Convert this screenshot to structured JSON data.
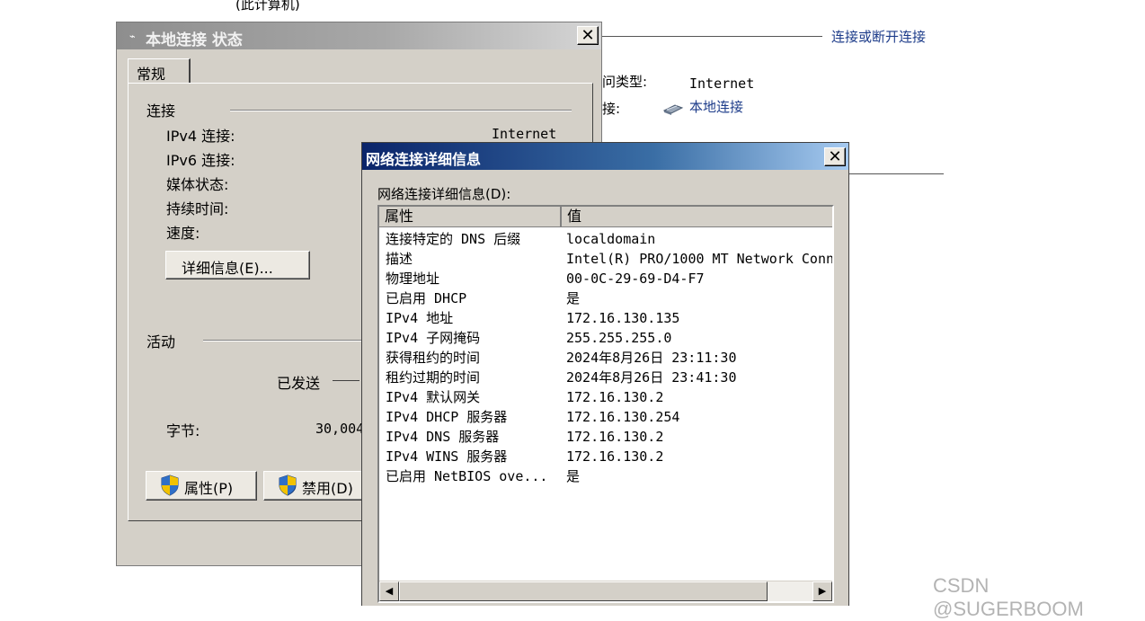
{
  "background": {
    "top_cut_text": "(此计算机)",
    "connect_link": "连接或断开连接",
    "access_type_label": "问类型:",
    "access_type_value": "Internet",
    "connections_label": "接:",
    "connection_link": "本地连接",
    "network_icon": "network-adapter-icon"
  },
  "status_dialog": {
    "title": "本地连接 状态",
    "close": "✕",
    "tab": "常规",
    "section_connection": "连接",
    "rows": {
      "ipv4": "IPv4 连接:",
      "ipv4_value": "Internet",
      "ipv6": "IPv6 连接:",
      "media": "媒体状态:",
      "duration": "持续时间:",
      "speed": "速度:"
    },
    "details_button": "详细信息(E)...",
    "section_activity": "活动",
    "sent_label": "已发送",
    "bytes_label": "字节:",
    "bytes_value": "30,004",
    "properties_button": "属性(P)",
    "disable_button": "禁用(D)"
  },
  "details_dialog": {
    "title": "网络连接详细信息",
    "close": "✕",
    "list_label": "网络连接详细信息(D):",
    "col_property": "属性",
    "col_value": "值",
    "rows": [
      {
        "prop": "连接特定的 DNS 后缀",
        "value": "localdomain"
      },
      {
        "prop": "描述",
        "value": "Intel(R) PRO/1000 MT Network Conn"
      },
      {
        "prop": "物理地址",
        "value": "00-0C-29-69-D4-F7"
      },
      {
        "prop": "已启用 DHCP",
        "value": "是"
      },
      {
        "prop": "IPv4 地址",
        "value": "172.16.130.135"
      },
      {
        "prop": "IPv4 子网掩码",
        "value": "255.255.255.0"
      },
      {
        "prop": "获得租约的时间",
        "value": "2024年8月26日 23:11:30"
      },
      {
        "prop": "租约过期的时间",
        "value": "2024年8月26日 23:41:30"
      },
      {
        "prop": "IPv4 默认网关",
        "value": "172.16.130.2"
      },
      {
        "prop": "IPv4 DHCP 服务器",
        "value": "172.16.130.254"
      },
      {
        "prop": "IPv4 DNS 服务器",
        "value": "172.16.130.2"
      },
      {
        "prop": "IPv4 WINS 服务器",
        "value": "172.16.130.2"
      },
      {
        "prop": "已启用 NetBIOS ove...",
        "value": "是"
      }
    ],
    "scroll_left": "◀",
    "scroll_right": "▶"
  },
  "watermark": "CSDN @SUGERBOOM"
}
